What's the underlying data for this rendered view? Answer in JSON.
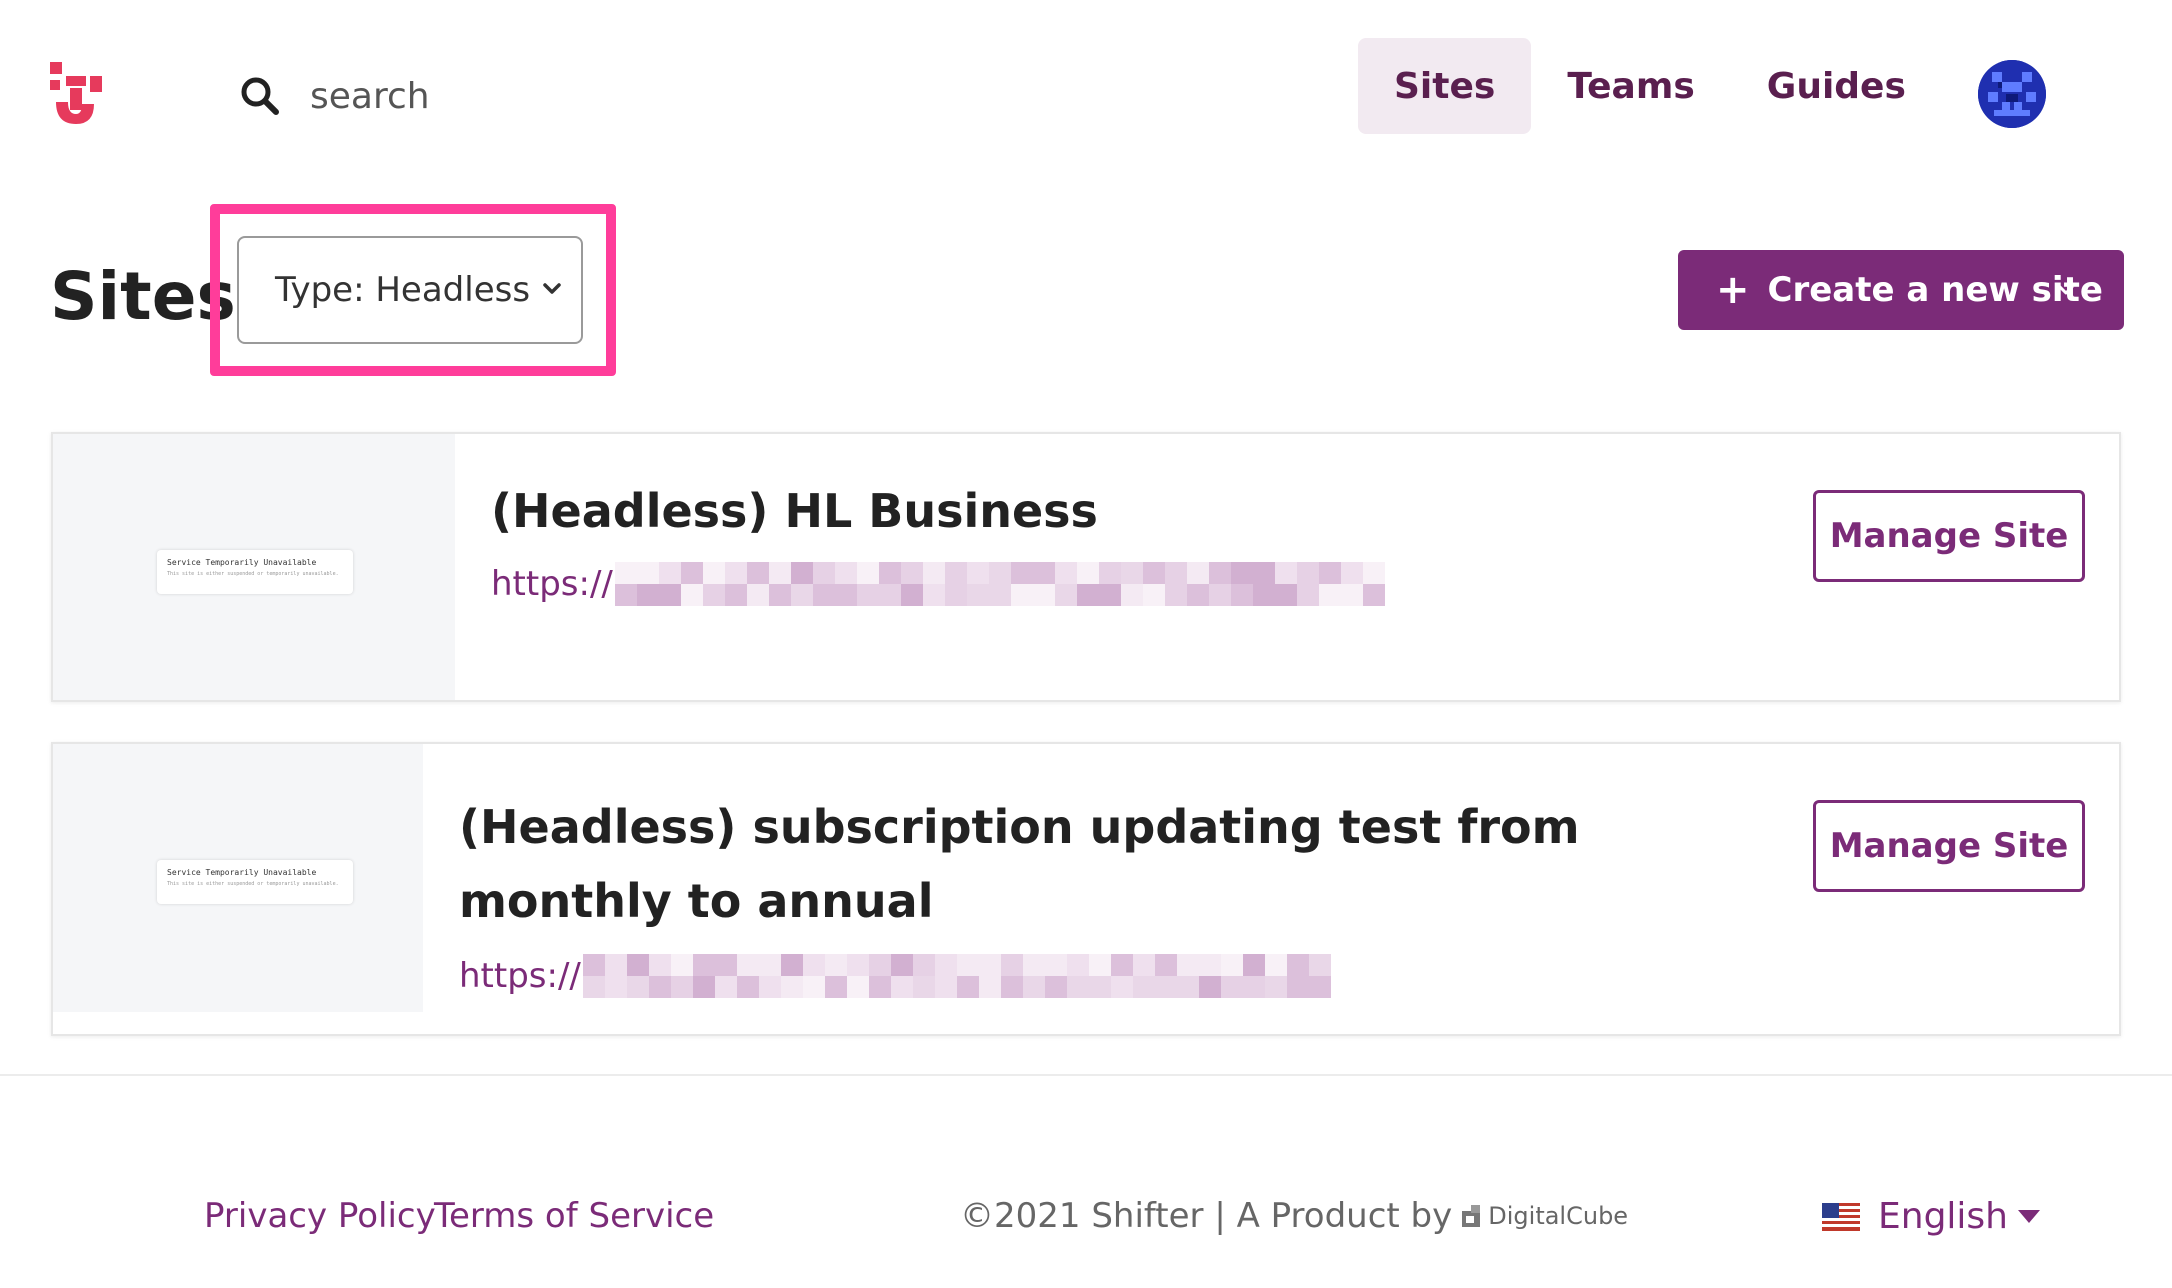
{
  "header": {
    "search_placeholder": "search",
    "nav": [
      "Sites",
      "Teams",
      "Guides"
    ],
    "active_nav": "Sites"
  },
  "main": {
    "title": "Sites",
    "type_filter": {
      "label": "Type: Headless",
      "selected": "Headless"
    },
    "create_button": "Create a new site",
    "sites": [
      {
        "name": "(Headless) HL Business",
        "url_prefix": "https://",
        "manage_label": "Manage Site"
      },
      {
        "name": "(Headless) subscription updating test from monthly to annual",
        "url_prefix": "https://",
        "manage_label": "Manage Site"
      }
    ],
    "thumbnail": {
      "heading": "Service Temporarily Unavailable",
      "text": "This site is either suspended or temporarily unavailable."
    }
  },
  "footer": {
    "privacy": "Privacy Policy",
    "terms": "Terms of Service",
    "copyright": "©2021 Shifter | A Product by",
    "company": "DigitalCube",
    "language": "English"
  },
  "colors": {
    "brand_purple": "#7b2b78",
    "nav_text": "#5a1f4f",
    "highlight_pink": "#ff3d9a",
    "logo_red": "#e63a5c"
  }
}
